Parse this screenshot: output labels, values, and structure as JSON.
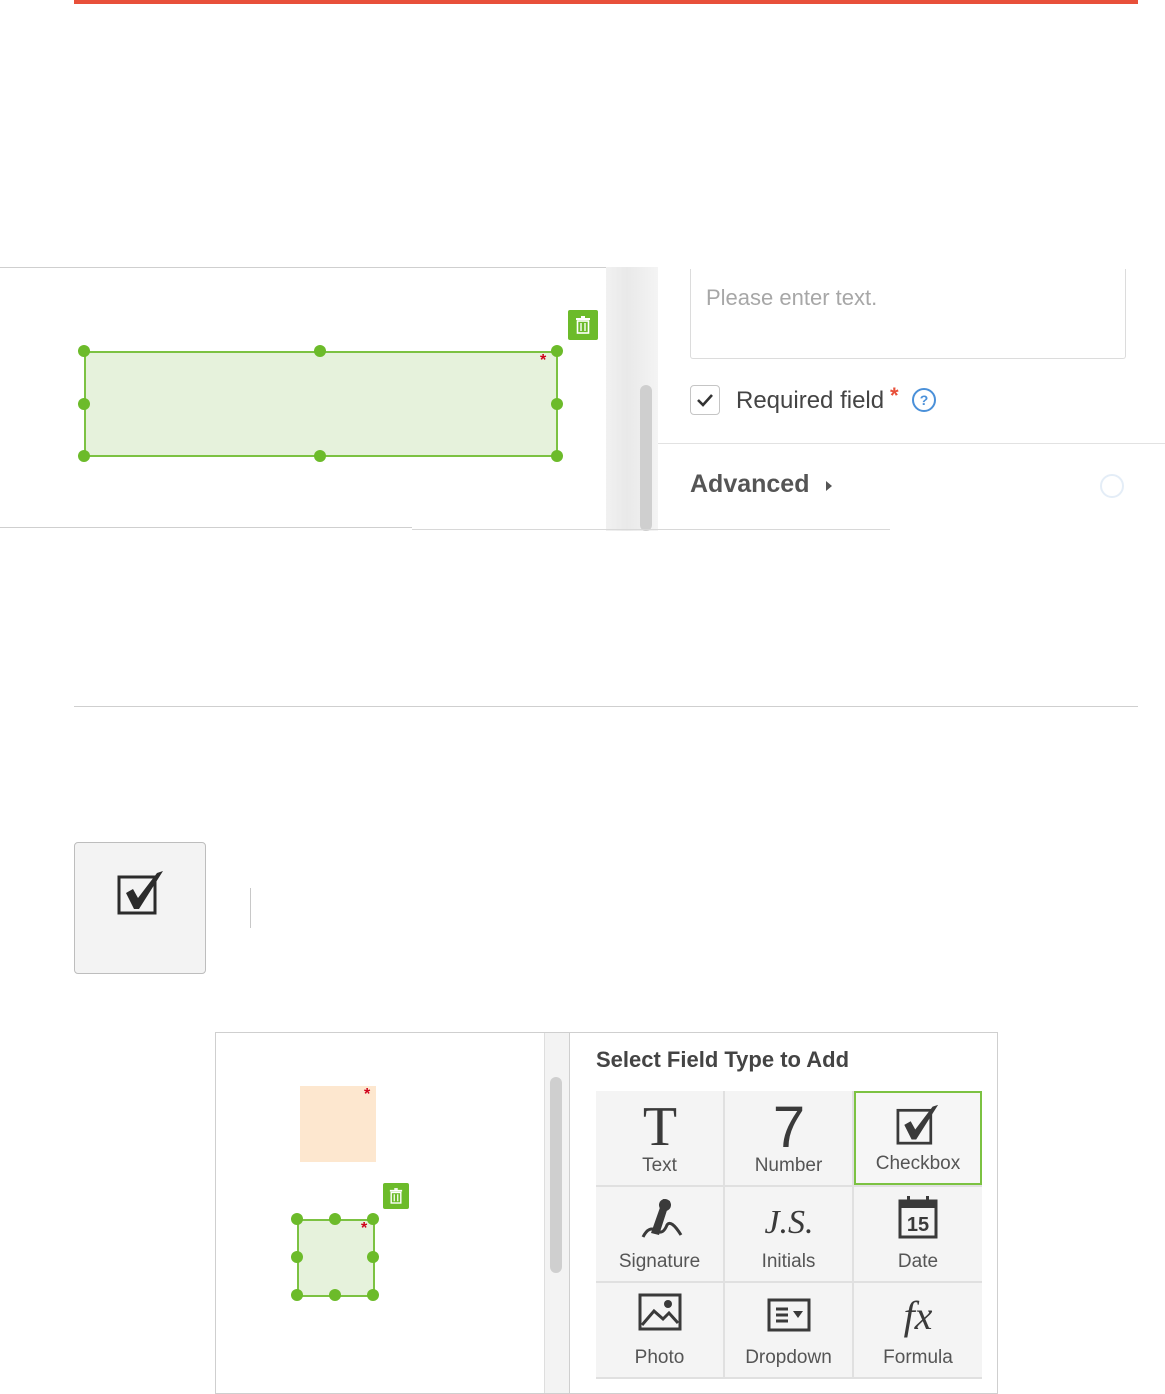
{
  "screenshot1": {
    "placeholder": "Please enter text.",
    "required_label": "Required field",
    "required_star": "*",
    "help_glyph": "?",
    "advanced_label": "Advanced",
    "field_required_marker": "*"
  },
  "toolbar": {
    "checkbox_tool_icon": "checkbox-checked-icon"
  },
  "screenshot2": {
    "title": "Select Field Type to Add",
    "field_required_marker": "*",
    "field_types": [
      {
        "label": "Text",
        "icon": "text-T-icon"
      },
      {
        "label": "Number",
        "icon": "number-7-icon"
      },
      {
        "label": "Checkbox",
        "icon": "checkbox-icon",
        "selected": true
      },
      {
        "label": "Signature",
        "icon": "signature-pen-icon"
      },
      {
        "label": "Initials",
        "icon": "initials-icon",
        "glyph": "J.S."
      },
      {
        "label": "Date",
        "icon": "calendar-icon",
        "glyph": "15"
      },
      {
        "label": "Photo",
        "icon": "photo-icon"
      },
      {
        "label": "Dropdown",
        "icon": "dropdown-icon"
      },
      {
        "label": "Formula",
        "icon": "formula-icon",
        "glyph": "fx"
      }
    ]
  },
  "colors": {
    "accent": "#e8503a",
    "field_green": "#7cc242",
    "field_fill": "#e6f2dc",
    "handle": "#6cbb2a",
    "required_red": "#d0021b",
    "help_blue": "#4a90d9",
    "pending_field": "#fde7cf"
  }
}
